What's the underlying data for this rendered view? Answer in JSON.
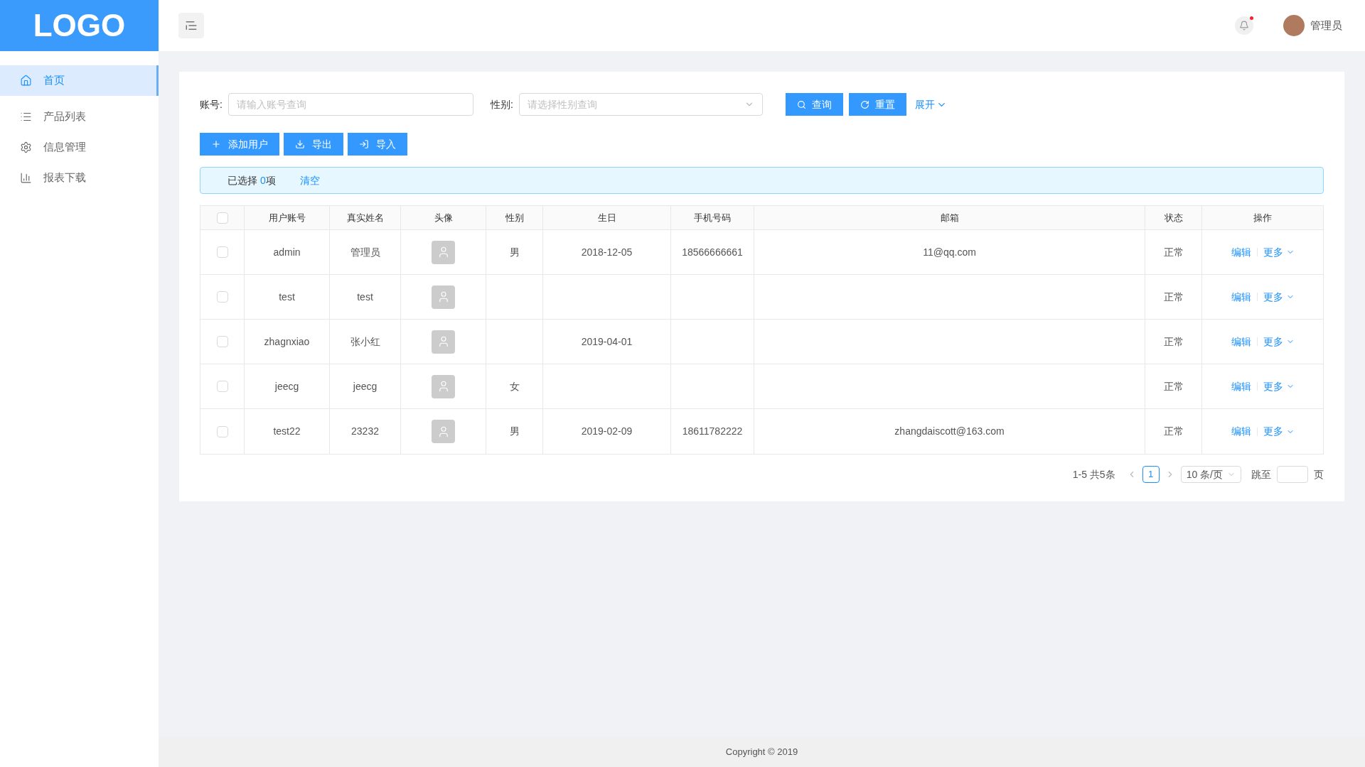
{
  "logo": "LOGO",
  "header": {
    "user_name": "管理员"
  },
  "sidebar": {
    "items": [
      {
        "label": "首页",
        "selected": true
      },
      {
        "label": "产品列表",
        "selected": false
      },
      {
        "label": "信息管理",
        "selected": false
      },
      {
        "label": "报表下载",
        "selected": false
      }
    ]
  },
  "search": {
    "fields": [
      {
        "label": "账号:",
        "placeholder": "请输入账号查询",
        "kind": "input"
      },
      {
        "label": "性别:",
        "placeholder": "请选择性别查询",
        "kind": "select"
      }
    ],
    "buttons": [
      {
        "label": "查询"
      },
      {
        "label": "重置"
      }
    ],
    "expand": "展开"
  },
  "actions": [
    {
      "label": "添加用户"
    },
    {
      "label": "导出"
    },
    {
      "label": "导入"
    }
  ],
  "selection": {
    "prefix": "已选择",
    "count": "0",
    "suffix": "项",
    "clear": "清空"
  },
  "table": {
    "all_checked": false,
    "columns": [
      "用户账号",
      "真实姓名",
      "头像",
      "性别",
      "生日",
      "手机号码",
      "邮箱",
      "状态",
      "操作"
    ],
    "rows": [
      {
        "checked": false,
        "account": "admin",
        "name": "管理员",
        "gender": "男",
        "birthday": "2018-12-05",
        "phone": "18566666661",
        "email": "11@qq.com",
        "status": "正常",
        "edit": "编辑",
        "more": "更多"
      },
      {
        "checked": false,
        "account": "test",
        "name": "test",
        "status": "正常",
        "edit": "编辑",
        "more": "更多"
      },
      {
        "checked": false,
        "account": "zhagnxiao",
        "name": "张小红",
        "birthday": "2019-04-01",
        "status": "正常",
        "edit": "编辑",
        "more": "更多"
      },
      {
        "checked": false,
        "account": "jeecg",
        "name": "jeecg",
        "gender": "女",
        "status": "正常",
        "edit": "编辑",
        "more": "更多"
      },
      {
        "checked": false,
        "account": "test22",
        "name": "23232",
        "gender": "男",
        "birthday": "2019-02-09",
        "phone": "18611782222",
        "email": "zhangdaiscott@163.com",
        "status": "正常",
        "edit": "编辑",
        "more": "更多"
      }
    ]
  },
  "pagination": {
    "total": "1-5 共5条",
    "pages": [
      {
        "label": "1",
        "selected": true
      }
    ],
    "page_size": "10 条/页",
    "jump_label": "跳至",
    "page_suffix": "页"
  },
  "footer": "Copyright © 2019"
}
